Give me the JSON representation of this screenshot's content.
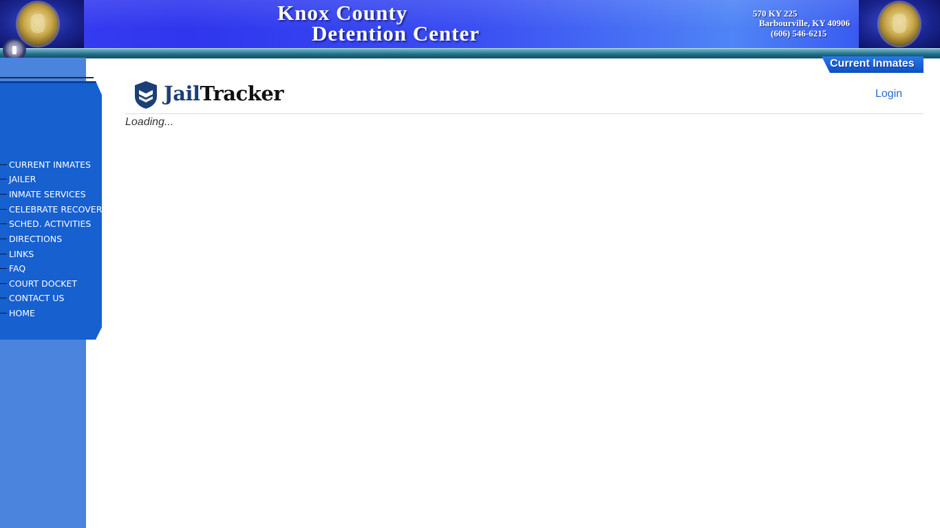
{
  "header": {
    "title_line1": "Knox County",
    "title_line2": "Detention Center",
    "address_line1": "570 KY 225",
    "address_line2": "Barbourville, KY 40906",
    "phone": "(606) 546-6215"
  },
  "sidebar": {
    "items": [
      {
        "label": "CURRENT INMATES"
      },
      {
        "label": "JAILER"
      },
      {
        "label": "INMATE SERVICES"
      },
      {
        "label": "CELEBRATE RECOVERY"
      },
      {
        "label": "SCHED. ACTIVITIES"
      },
      {
        "label": "DIRECTIONS"
      },
      {
        "label": "LINKS"
      },
      {
        "label": "FAQ"
      },
      {
        "label": "COURT DOCKET"
      },
      {
        "label": "CONTACT US"
      },
      {
        "label": "HOME"
      }
    ]
  },
  "page_tab": {
    "label": "Current Inmates"
  },
  "jailtracker": {
    "logo_part1": "Jail",
    "logo_part2": "Tracker",
    "login_label": "Login",
    "status_text": "Loading..."
  },
  "colors": {
    "header_blue": "#3a4ef2",
    "sidebar_blue": "#4a84dc",
    "menu_blue": "#1660d0",
    "login_link": "#2868c8",
    "logo_navy": "#1c3f76"
  },
  "icons": {
    "state_seal": "kentucky-seal-icon",
    "shield": "jailtracker-shield-icon"
  }
}
